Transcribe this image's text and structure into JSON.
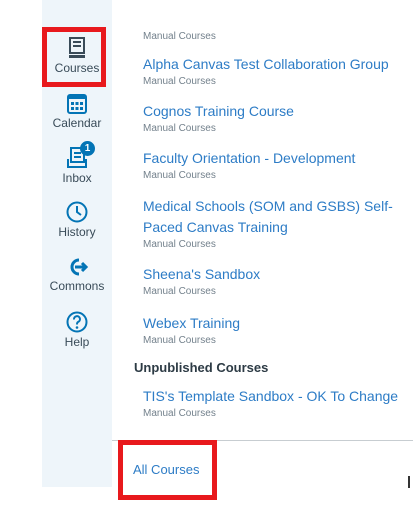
{
  "nav": {
    "items": [
      {
        "label": "Courses",
        "icon": "courses-icon"
      },
      {
        "label": "Calendar",
        "icon": "calendar-icon"
      },
      {
        "label": "Inbox",
        "icon": "inbox-icon",
        "badge": "1"
      },
      {
        "label": "History",
        "icon": "history-icon"
      },
      {
        "label": "Commons",
        "icon": "commons-icon"
      },
      {
        "label": "Help",
        "icon": "help-icon"
      }
    ]
  },
  "courses": {
    "top_term": "Manual Courses",
    "list": [
      {
        "name": "Alpha Canvas Test Collaboration Group",
        "term": "Manual Courses"
      },
      {
        "name": "Cognos Training Course",
        "term": "Manual Courses"
      },
      {
        "name": "Faculty Orientation - Development",
        "term": "Manual Courses"
      },
      {
        "name": "Medical Schools (SOM and GSBS) Self-Paced Canvas Training",
        "term": "Manual Courses"
      },
      {
        "name": "Sheena's Sandbox",
        "term": "Manual Courses"
      },
      {
        "name": "Webex Training",
        "term": "Manual Courses"
      }
    ],
    "unpublished_heading": "Unpublished Courses",
    "unpublished": [
      {
        "name": "TIS's Template Sandbox - OK To Change",
        "term": "Manual Courses"
      }
    ],
    "all_courses_label": "All Courses"
  },
  "colors": {
    "link": "#2d7cc6",
    "icon": "#0374b5",
    "highlight": "#e8191d",
    "nav_bg": "#eef5fa"
  }
}
